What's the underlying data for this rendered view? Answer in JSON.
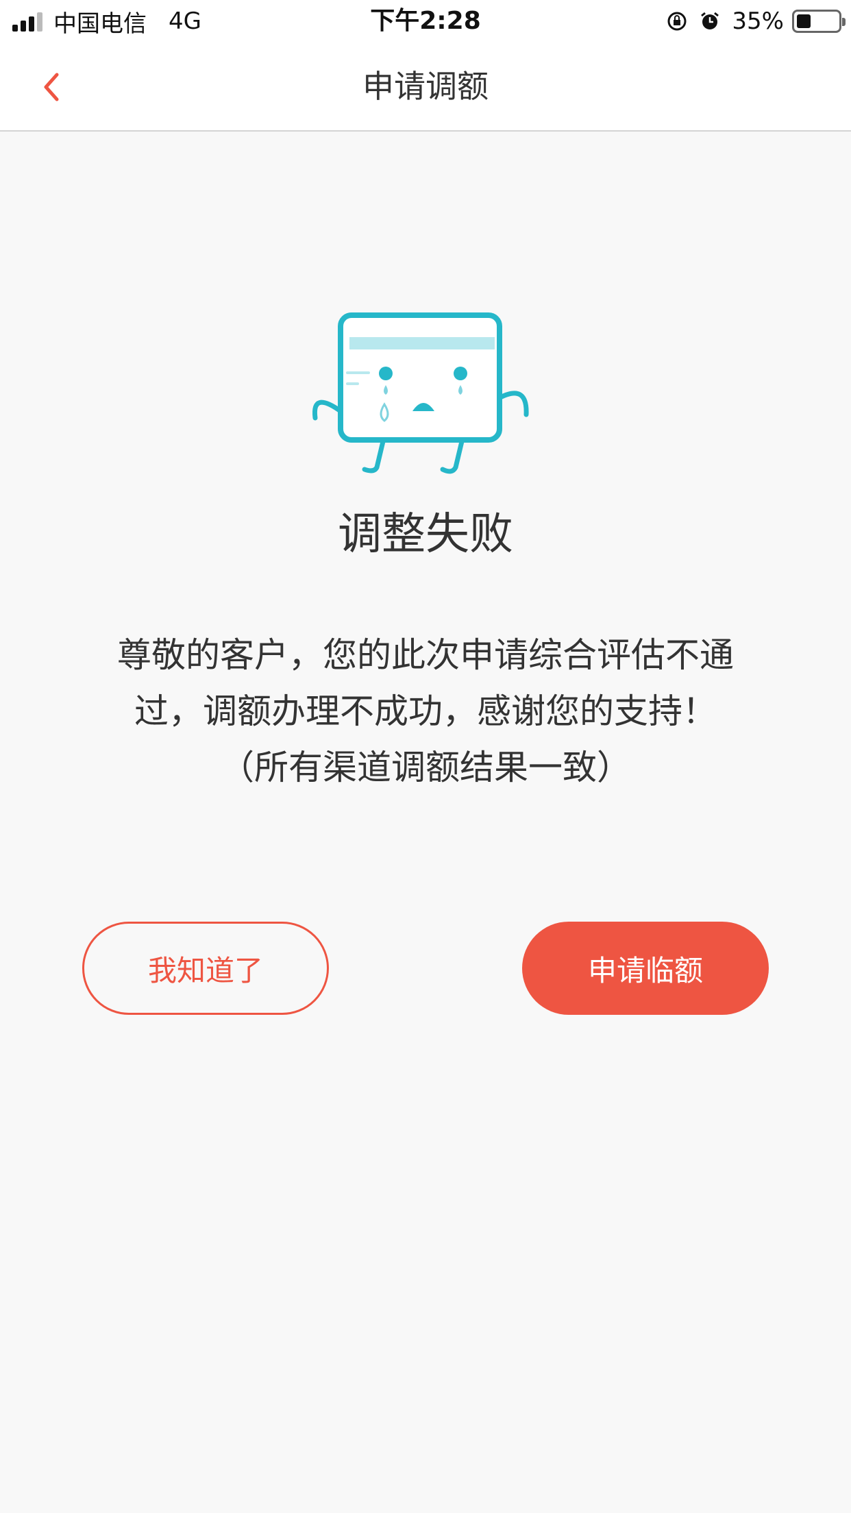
{
  "status_bar": {
    "carrier": "中国电信",
    "network": "4G",
    "time": "下午2:28",
    "battery": "35%",
    "battery_level": 0.35,
    "icons": [
      "signal-icon",
      "rotation-lock-icon",
      "alarm-icon",
      "battery-icon"
    ]
  },
  "nav": {
    "title": "申请调额",
    "back_icon": "chevron-left-icon"
  },
  "result": {
    "icon": "crying-card-illustration",
    "title": "调整失败",
    "message": "尊敬的客户，您的此次申请综合评估不通过，调额办理不成功，感谢您的支持！（所有渠道调额结果一致）"
  },
  "buttons": {
    "acknowledge": "我知道了",
    "apply_temp": "申请临额"
  },
  "colors": {
    "accent": "#ee5542",
    "illustration": "#26b7c9",
    "background": "#f8f8f8"
  }
}
